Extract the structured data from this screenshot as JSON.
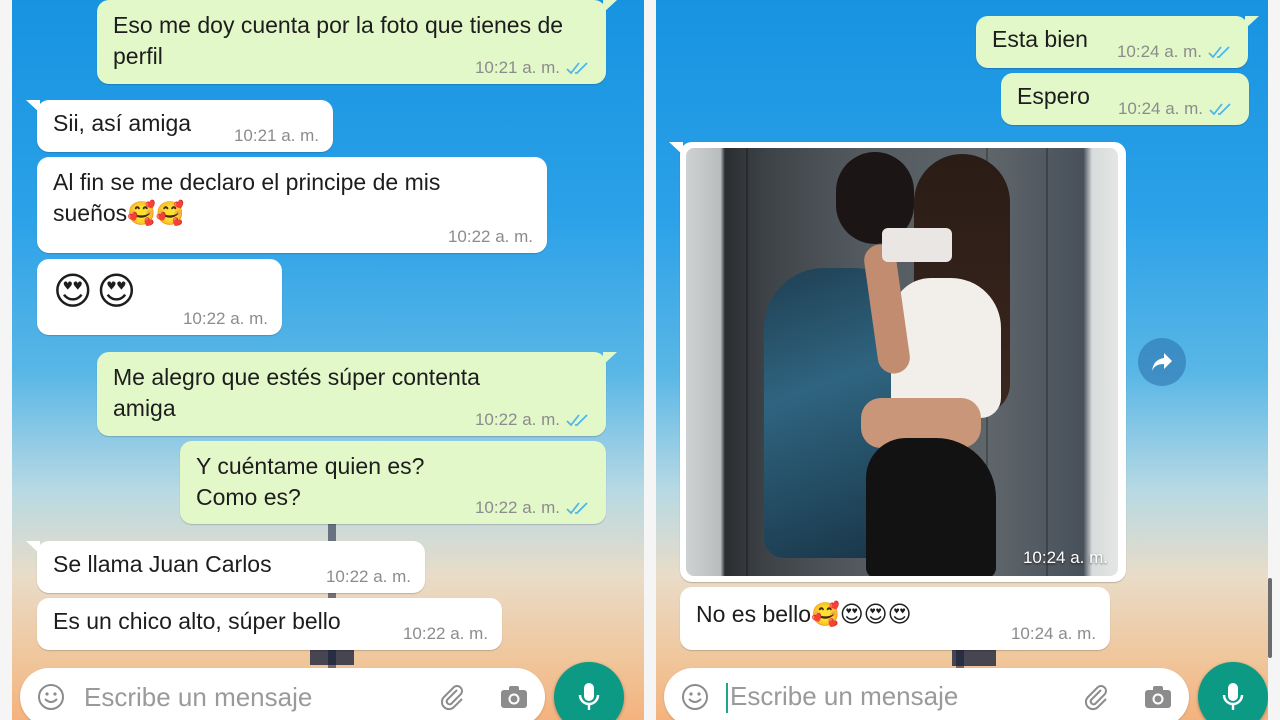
{
  "colors": {
    "outgoing_bubble": "#e2f8c9",
    "incoming_bubble": "#ffffff",
    "read_ticks": "#4fb6ec",
    "mic_button": "#0d9a84",
    "timestamp": "#8c8c8c"
  },
  "left_chat": {
    "messages": [
      {
        "direction": "out",
        "text": "Eso me doy cuenta por la foto que tienes de perfil",
        "time": "10:21 a. m.",
        "status": "read"
      },
      {
        "direction": "in",
        "text": "Sii, así amiga",
        "time": "10:21 a. m."
      },
      {
        "direction": "in",
        "text": "Al fin se me declaro el principe de mis sueños🥰🥰",
        "time": "10:22 a. m."
      },
      {
        "direction": "in",
        "text": "😍😍",
        "time": "10:22 a. m."
      },
      {
        "direction": "out",
        "text": "Me alegro que estés súper contenta amiga",
        "time": "10:22 a. m.",
        "status": "read"
      },
      {
        "direction": "out",
        "text": "Y cuéntame quien es? Como es?",
        "time": "10:22 a. m.",
        "status": "read"
      },
      {
        "direction": "in",
        "text": "Se llama Juan Carlos",
        "time": "10:22 a. m."
      },
      {
        "direction": "in",
        "text": "Es un chico alto, súper bello",
        "time": "10:22 a. m."
      }
    ],
    "input": {
      "placeholder": "Escribe un mensaje"
    }
  },
  "right_chat": {
    "messages": [
      {
        "direction": "out",
        "text": "Esta bien",
        "time": "10:24 a. m.",
        "status": "read"
      },
      {
        "direction": "out",
        "text": "Espero",
        "time": "10:24 a. m.",
        "status": "read"
      },
      {
        "direction": "in",
        "type": "image",
        "time": "10:24 a. m."
      },
      {
        "direction": "in",
        "text": "No es bello🥰😍😍😍",
        "time": "10:24 a. m."
      }
    ],
    "input": {
      "placeholder": "Escribe un mensaje"
    }
  },
  "icons": {
    "emoji": "emoji-icon",
    "attach": "paperclip-icon",
    "camera": "camera-icon",
    "mic": "mic-icon",
    "forward": "forward-icon",
    "read_receipt": "double-check-icon"
  }
}
